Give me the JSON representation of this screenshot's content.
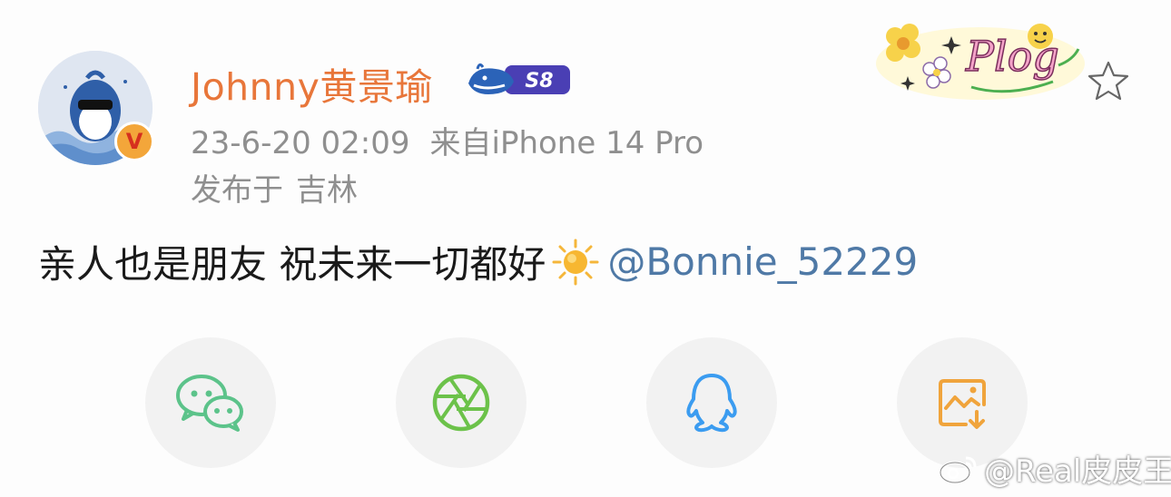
{
  "post": {
    "username": "Johnny黄景瑜",
    "level_badge": "S8",
    "verified_badge": "V",
    "timestamp": "23-6-20 02:09",
    "source": "来自iPhone 14 Pro",
    "location_prefix": "发布于",
    "location": "吉林",
    "content": "亲人也是朋友 祝未来一切都好",
    "emoji": "sun-emoji",
    "mention": "@Bonnie_52229",
    "decoration_text": "Plog"
  },
  "share_buttons": [
    {
      "name": "wechat-icon",
      "color": "#5cc38a"
    },
    {
      "name": "moments-icon",
      "color": "#6cc24a"
    },
    {
      "name": "qq-icon",
      "color": "#3b9cf0"
    },
    {
      "name": "save-image-icon",
      "color": "#f0a43c"
    }
  ],
  "watermark": {
    "text": "@Real皮皮王",
    "icon": "weibo-logo-icon"
  },
  "colors": {
    "username": "#e8763a",
    "meta": "#8f8f8f",
    "mention": "#4f79a6",
    "text": "#1a1a1a"
  }
}
